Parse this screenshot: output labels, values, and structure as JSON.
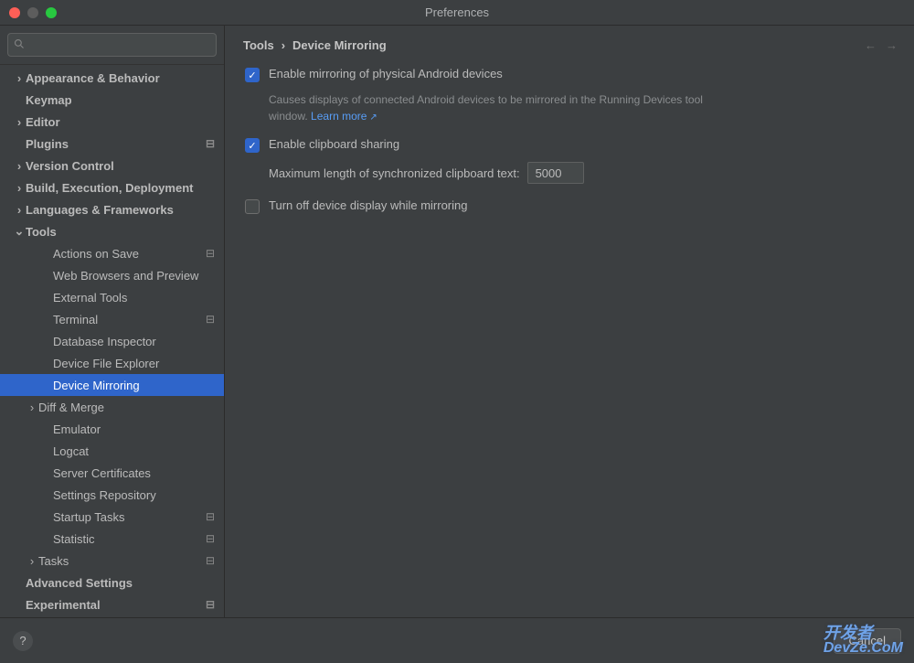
{
  "window": {
    "title": "Preferences"
  },
  "search": {
    "placeholder": ""
  },
  "sidebar": {
    "items": [
      {
        "label": "Appearance & Behavior",
        "lvl": 0,
        "chev": "right",
        "bold": true,
        "selected": false,
        "marker": ""
      },
      {
        "label": "Keymap",
        "lvl": 0,
        "chev": "",
        "bold": true,
        "selected": false,
        "marker": ""
      },
      {
        "label": "Editor",
        "lvl": 0,
        "chev": "right",
        "bold": true,
        "selected": false,
        "marker": ""
      },
      {
        "label": "Plugins",
        "lvl": 0,
        "chev": "",
        "bold": true,
        "selected": false,
        "marker": "⊟"
      },
      {
        "label": "Version Control",
        "lvl": 0,
        "chev": "right",
        "bold": true,
        "selected": false,
        "marker": ""
      },
      {
        "label": "Build, Execution, Deployment",
        "lvl": 0,
        "chev": "right",
        "bold": true,
        "selected": false,
        "marker": ""
      },
      {
        "label": "Languages & Frameworks",
        "lvl": 0,
        "chev": "right",
        "bold": true,
        "selected": false,
        "marker": ""
      },
      {
        "label": "Tools",
        "lvl": 0,
        "chev": "down",
        "bold": true,
        "selected": false,
        "marker": ""
      },
      {
        "label": "Actions on Save",
        "lvl": 2,
        "chev": "",
        "bold": false,
        "selected": false,
        "marker": "⊟"
      },
      {
        "label": "Web Browsers and Preview",
        "lvl": 2,
        "chev": "",
        "bold": false,
        "selected": false,
        "marker": ""
      },
      {
        "label": "External Tools",
        "lvl": 2,
        "chev": "",
        "bold": false,
        "selected": false,
        "marker": ""
      },
      {
        "label": "Terminal",
        "lvl": 2,
        "chev": "",
        "bold": false,
        "selected": false,
        "marker": "⊟"
      },
      {
        "label": "Database Inspector",
        "lvl": 2,
        "chev": "",
        "bold": false,
        "selected": false,
        "marker": ""
      },
      {
        "label": "Device File Explorer",
        "lvl": 2,
        "chev": "",
        "bold": false,
        "selected": false,
        "marker": ""
      },
      {
        "label": "Device Mirroring",
        "lvl": 2,
        "chev": "",
        "bold": false,
        "selected": true,
        "marker": ""
      },
      {
        "label": "Diff & Merge",
        "lvl": 1,
        "chev": "right",
        "bold": false,
        "selected": false,
        "marker": ""
      },
      {
        "label": "Emulator",
        "lvl": 2,
        "chev": "",
        "bold": false,
        "selected": false,
        "marker": ""
      },
      {
        "label": "Logcat",
        "lvl": 2,
        "chev": "",
        "bold": false,
        "selected": false,
        "marker": ""
      },
      {
        "label": "Server Certificates",
        "lvl": 2,
        "chev": "",
        "bold": false,
        "selected": false,
        "marker": ""
      },
      {
        "label": "Settings Repository",
        "lvl": 2,
        "chev": "",
        "bold": false,
        "selected": false,
        "marker": ""
      },
      {
        "label": "Startup Tasks",
        "lvl": 2,
        "chev": "",
        "bold": false,
        "selected": false,
        "marker": "⊟"
      },
      {
        "label": "Statistic",
        "lvl": 2,
        "chev": "",
        "bold": false,
        "selected": false,
        "marker": "⊟"
      },
      {
        "label": "Tasks",
        "lvl": 1,
        "chev": "right",
        "bold": false,
        "selected": false,
        "marker": "⊟"
      },
      {
        "label": "Advanced Settings",
        "lvl": 0,
        "chev": "",
        "bold": true,
        "selected": false,
        "marker": ""
      },
      {
        "label": "Experimental",
        "lvl": 0,
        "chev": "",
        "bold": true,
        "selected": false,
        "marker": "⊟"
      }
    ]
  },
  "breadcrumb": {
    "root": "Tools",
    "sep": "›",
    "leaf": "Device Mirroring"
  },
  "options": {
    "enable_mirroring": {
      "label": "Enable mirroring of physical Android devices",
      "checked": true
    },
    "mirroring_desc": "Causes displays of connected Android devices to be mirrored in the Running Devices tool window.",
    "learn_more": "Learn more",
    "enable_clipboard": {
      "label": "Enable clipboard sharing",
      "checked": true
    },
    "clipboard_len_label": "Maximum length of synchronized clipboard text:",
    "clipboard_len_value": "5000",
    "turn_off_display": {
      "label": "Turn off device display while mirroring",
      "checked": false
    }
  },
  "footer": {
    "cancel": "Cancel"
  },
  "watermark": {
    "l1": "开发者",
    "l2": "DevZe.CoM"
  }
}
